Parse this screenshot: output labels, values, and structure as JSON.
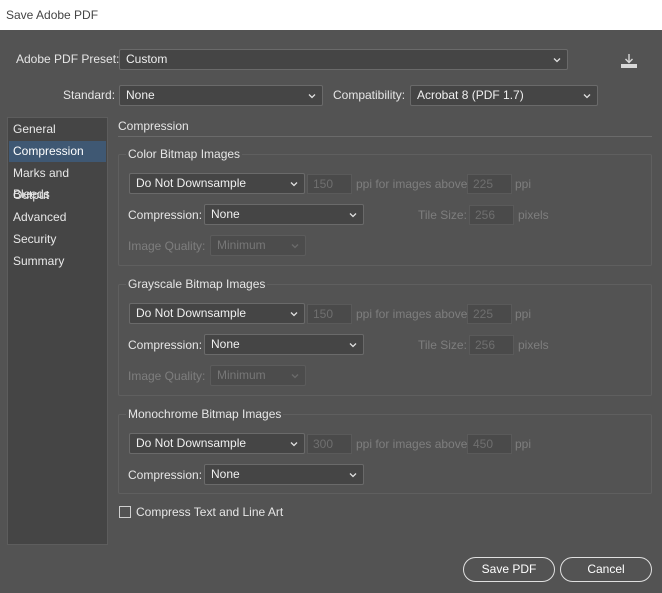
{
  "window": {
    "title": "Save Adobe PDF"
  },
  "preset": {
    "label": "Adobe PDF Preset:",
    "value": "Custom"
  },
  "standard": {
    "label": "Standard:",
    "value": "None"
  },
  "compatibility": {
    "label": "Compatibility:",
    "value": "Acrobat 8 (PDF 1.7)"
  },
  "sidebar": {
    "items": [
      {
        "label": "General"
      },
      {
        "label": "Compression"
      },
      {
        "label": "Marks and Bleeds"
      },
      {
        "label": "Output"
      },
      {
        "label": "Advanced"
      },
      {
        "label": "Security"
      },
      {
        "label": "Summary"
      }
    ],
    "selected": "Compression"
  },
  "main": {
    "heading": "Compression"
  },
  "color_bitmap": {
    "title": "Color Bitmap Images",
    "downsample": "Do Not Downsample",
    "ppi": "150",
    "ppi_above_label": "ppi for images above",
    "above": "225",
    "ppi_unit": "ppi",
    "compression_label": "Compression:",
    "compression": "None",
    "tile_label": "Tile Size:",
    "tile": "256",
    "tile_unit": "pixels",
    "quality_label": "Image Quality:",
    "quality": "Minimum"
  },
  "gray_bitmap": {
    "title": "Grayscale Bitmap Images",
    "downsample": "Do Not Downsample",
    "ppi": "150",
    "ppi_above_label": "ppi for images above",
    "above": "225",
    "ppi_unit": "ppi",
    "compression_label": "Compression:",
    "compression": "None",
    "tile_label": "Tile Size:",
    "tile": "256",
    "tile_unit": "pixels",
    "quality_label": "Image Quality:",
    "quality": "Minimum"
  },
  "mono_bitmap": {
    "title": "Monochrome Bitmap Images",
    "downsample": "Do Not Downsample",
    "ppi": "300",
    "ppi_above_label": "ppi for images above",
    "above": "450",
    "ppi_unit": "ppi",
    "compression_label": "Compression:",
    "compression": "None"
  },
  "compress_text": {
    "label": "Compress Text and Line Art",
    "checked": false
  },
  "buttons": {
    "save": "Save PDF",
    "cancel": "Cancel"
  }
}
